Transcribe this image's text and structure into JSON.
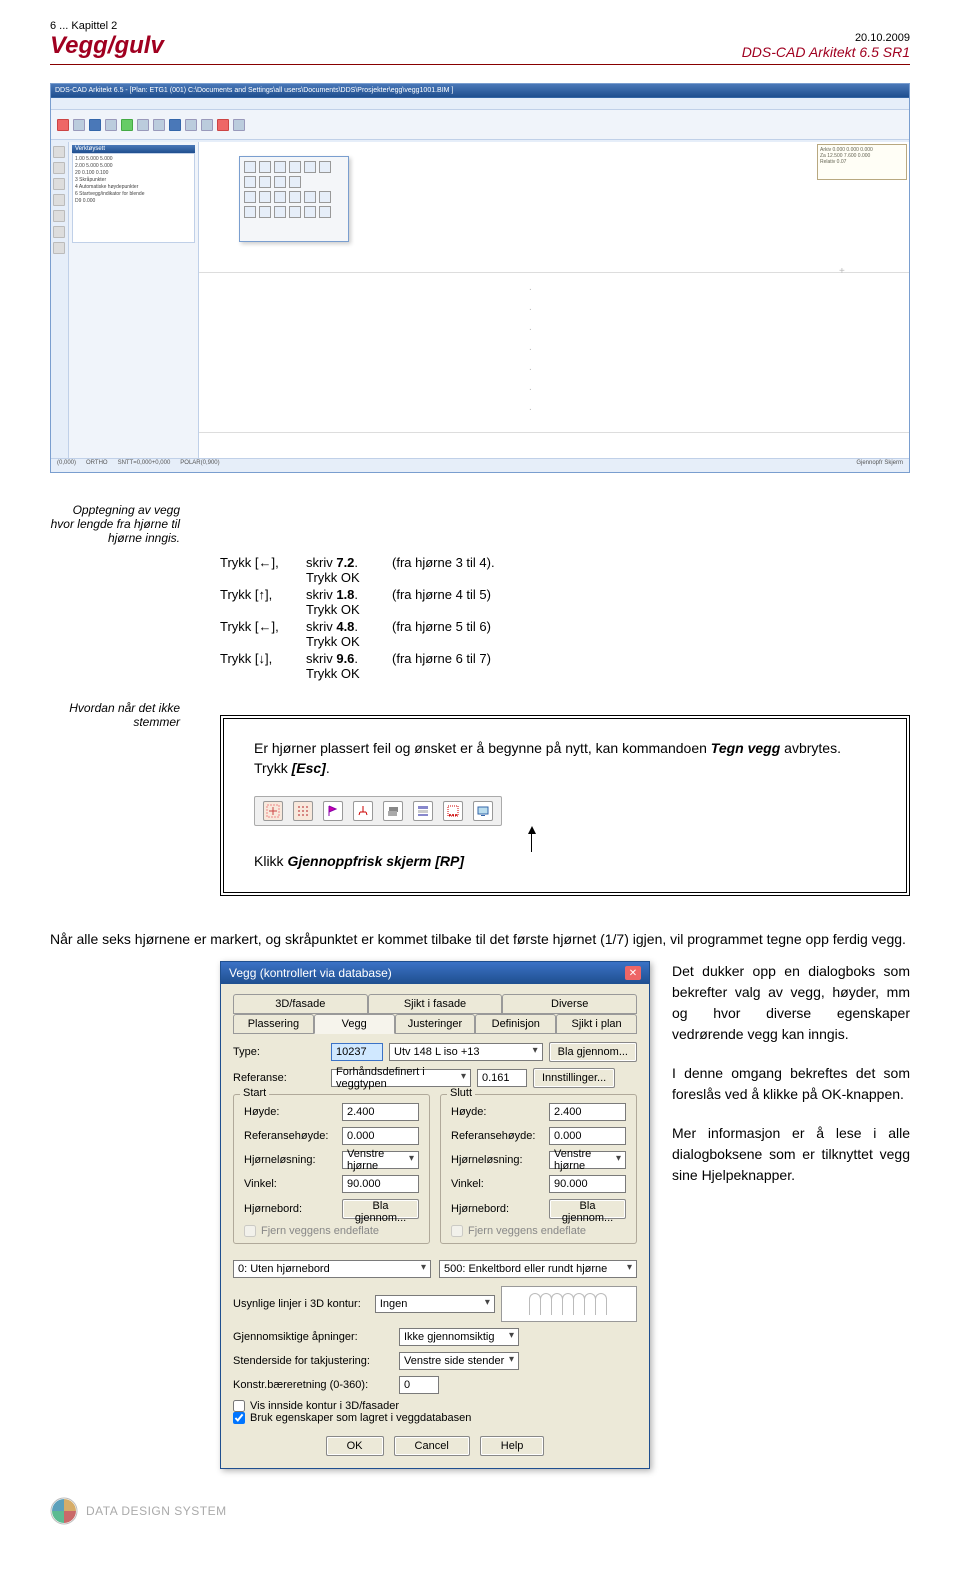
{
  "header": {
    "chapter": "6 ... Kapittel 2",
    "title": "Vegg/gulv",
    "date": "20.10.2009",
    "product": "DDS-CAD Arkitekt 6.5 SR1"
  },
  "app": {
    "titlebar": "DDS-CAD Arkitekt 6.5 - [Plan: ETG1 (001)  C:\\Documents and Settings\\all users\\Documents\\DDS\\Prosjekter\\egg\\vegg1001.BIM ]",
    "panel_title": "Verktøysett",
    "panel_lines": [
      "1.00   5.000   5.000",
      "2.00   5.000   5.000",
      "20     0.100   0.100",
      "3 Skråpunkter",
      "4 Automatiske høydepunkter",
      "6 Startvegg/indikator for blende",
      "D9   0.000"
    ],
    "coord_box": [
      "Arkiv 0.000  0.000  0.000",
      "Za 12.500  7.600  0.000",
      "Relativ 0.07"
    ],
    "status": [
      "",
      "",
      "(0,000)",
      "ORTHO",
      "SNTT=0,000+0,000",
      "POLAR(0,900)",
      "",
      "Gjennopfr Skjerm"
    ]
  },
  "margin_notes": {
    "note1": "Opptegning av vegg hvor lengde fra hjørne til hjørne inngis.",
    "note2": "Hvordan når det ikke stemmer"
  },
  "key_steps": [
    {
      "key": "Trykk [←],",
      "cmd_pre": "skriv ",
      "cmd_b": "7.2",
      "cmd_post": ". Trykk OK",
      "result": "(fra hjørne 3 til 4)."
    },
    {
      "key": "Trykk [↑],",
      "cmd_pre": "skriv ",
      "cmd_b": "1.8",
      "cmd_post": ". Trykk OK",
      "result": "(fra hjørne 4 til 5)"
    },
    {
      "key": "Trykk [←],",
      "cmd_pre": "skriv ",
      "cmd_b": "4.8",
      "cmd_post": ". Trykk OK",
      "result": "(fra hjørne 5 til 6)"
    },
    {
      "key": "Trykk [↓],",
      "cmd_pre": "skriv ",
      "cmd_b": "9.6",
      "cmd_post": ". Trykk OK",
      "result": "(fra hjørne 6 til 7)"
    }
  ],
  "box": {
    "p1_a": "Er hjørner plassert feil og ønsket er å begynne på nytt, kan kommandoen ",
    "p1_b": "Tegn vegg",
    "p1_c": " avbrytes. Trykk ",
    "p1_d": "[Esc]",
    "p1_e": ".",
    "p2_a": "Klikk ",
    "p2_b": "Gjennoppfrisk skjerm [RP]"
  },
  "toolbar_icons": [
    "expand-icon",
    "grid-icon",
    "flag-icon",
    "anchor-icon",
    "layer-icon",
    "stack-icon",
    "markers-icon",
    "screen-icon"
  ],
  "para1": "Når alle seks hjørnene er markert, og skråpunktet er kommet tilbake til det første hjørnet (1/7) igjen, vil programmet tegne opp ferdig vegg.",
  "dialog": {
    "title": "Vegg (kontrollert via database)",
    "tabs_top": [
      "3D/fasade",
      "Sjikt i fasade",
      "Diverse"
    ],
    "tabs_mid": [
      "Plassering",
      "Vegg",
      "Justeringer",
      "Definisjon",
      "Sjikt i plan"
    ],
    "type_label": "Type:",
    "type_code": "10237",
    "type_desc": "Utv 148 L iso +13",
    "browse_btn": "Bla gjennom...",
    "ref_label": "Referanse:",
    "ref_value": "Forhåndsdefinert i veggtypen",
    "ref_num": "0.161",
    "settings_btn": "Innstillinger...",
    "start_label": "Start",
    "end_label": "Slutt",
    "height_label": "Høyde:",
    "height_val": "2.400",
    "refh_label": "Referansehøyde:",
    "refh_val": "0.000",
    "corner_label": "Hjørneløsning:",
    "corner_val": "Venstre hjørne",
    "angle_label": "Vinkel:",
    "angle_val": "90.000",
    "hjbord_label": "Hjørnebord:",
    "fjern_start": "Fjern veggens endeflate",
    "fjern_end": "Fjern veggens endeflate",
    "div_left": "0: Uten hjørnebord",
    "div_right": "500: Enkeltbord eller rundt hjørne",
    "usynlige_label": "Usynlige linjer i 3D kontur:",
    "usynlige_val": "Ingen",
    "gjennom_label": "Gjennomsiktige åpninger:",
    "gjennom_val": "Ikke gjennomsiktig",
    "stender_label": "Stenderside for takjustering:",
    "stender_val": "Venstre side stender",
    "konstr_label": "Konstr.bæreretning (0-360):",
    "konstr_val": "0",
    "chk1": "Vis innside kontur i 3D/fasader",
    "chk2": "Bruk egenskaper som lagret i veggdatabasen",
    "ok": "OK",
    "cancel": "Cancel",
    "help": "Help"
  },
  "right_text": {
    "p1": "Det dukker opp en dialogboks som bekrefter valg av vegg, høyder, mm og hvor diverse egenskaper vedrørende vegg kan inngis.",
    "p2": "I denne omgang bekreftes det som foreslås ved å klikke på OK-knappen.",
    "p3": "Mer informasjon er å lese i alle dialogboksene som er tilknyttet vegg sine Hjelpeknapper."
  },
  "footer": {
    "company": "DATA DESIGN SYSTEM"
  }
}
